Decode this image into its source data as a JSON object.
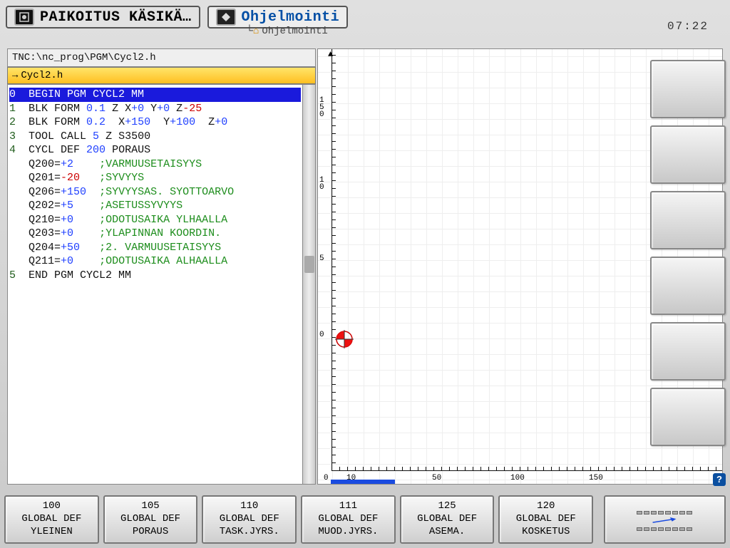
{
  "header": {
    "tab1": "PAIKOITUS KÄSIKÄ…",
    "tab2": "Ohjelmointi",
    "tab2sub": "Ohjelmointi",
    "clock": "07:22"
  },
  "path": "TNC:\\nc_prog\\PGM\\Cycl2.h",
  "file": "Cycl2.h",
  "code": {
    "l0": "0  BEGIN PGM CYCL2 MM",
    "l1n": "1",
    "l1a": "BLK FORM",
    "l1b": "0.1",
    "l1c": "Z X",
    "l1d": "+0",
    "l1e": "Y",
    "l1f": "+0",
    "l1g": "Z",
    "l1h": "-25",
    "l2n": "2",
    "l2a": "BLK FORM",
    "l2b": "0.2",
    "l2c": "X",
    "l2d": "+150",
    "l2e": "Y",
    "l2f": "+100",
    "l2g": "Z",
    "l2h": "+0",
    "l3n": "3",
    "l3a": "TOOL CALL",
    "l3b": "5",
    "l3c": "Z S3500",
    "l4n": "4",
    "l4a": "CYCL DEF",
    "l4b": "200",
    "l4c": "PORAUS",
    "q200a": "Q200=",
    "q200b": "+2",
    "q200c": ";VARMUUSETAISYYS",
    "q201a": "Q201=",
    "q201b": "-20",
    "q201c": ";SYVYYS",
    "q206a": "Q206=",
    "q206b": "+150",
    "q206c": ";SYVYYSAS. SYOTTOARVO",
    "q202a": "Q202=",
    "q202b": "+5",
    "q202c": ";ASETUSSYVYYS",
    "q210a": "Q210=",
    "q210b": "+0",
    "q210c": ";ODOTUSAIKA YLHAALLA",
    "q203a": "Q203=",
    "q203b": "+0",
    "q203c": ";YLAPINNAN KOORDIN.",
    "q204a": "Q204=",
    "q204b": "+50",
    "q204c": ";2. VARMUUSETAISYYS",
    "q211a": "Q211=",
    "q211b": "+0",
    "q211c": ";ODOTUSAIKA ALHAALLA",
    "l5n": "5",
    "l5a": "END PGM CYCL2 MM"
  },
  "xlabels": {
    "a": "0",
    "b": "10",
    "c": "50",
    "d": "100",
    "e": "150"
  },
  "ylabels": {
    "a": "1",
    "b": "5",
    "c": "0",
    "d": "1",
    "e": "0",
    "f": "5",
    "g": "0"
  },
  "soft": {
    "b1a": "100",
    "b1b": "GLOBAL DEF",
    "b1c": "YLEINEN",
    "b2a": "105",
    "b2b": "GLOBAL DEF",
    "b2c": "PORAUS",
    "b3a": "110",
    "b3b": "GLOBAL DEF",
    "b3c": "TASK.JYRS.",
    "b4a": "111",
    "b4b": "GLOBAL DEF",
    "b4c": "MUOD.JYRS.",
    "b5a": "125",
    "b5b": "GLOBAL DEF",
    "b5c": "ASEMA.",
    "b6a": "120",
    "b6b": "GLOBAL DEF",
    "b6c": "KOSKETUS"
  }
}
